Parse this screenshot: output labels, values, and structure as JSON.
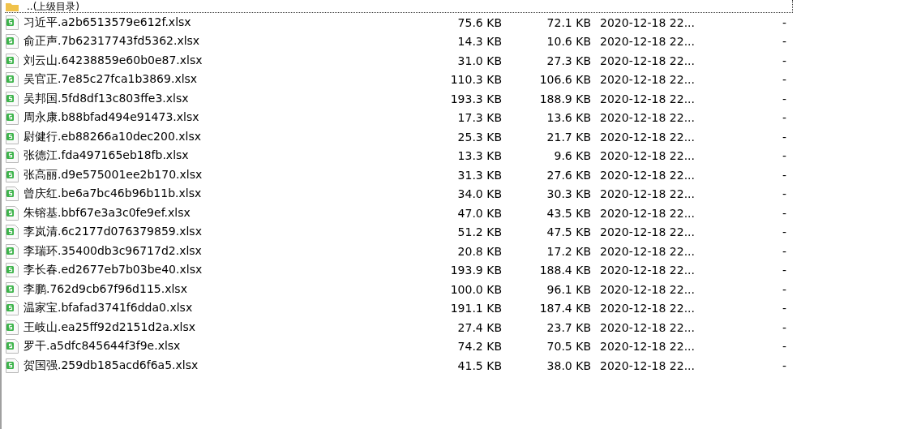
{
  "parent_row": {
    "name": "..(上级目录)",
    "focused": true
  },
  "files": [
    {
      "name": "习近平.a2b6513579e612f.xlsx",
      "size": "75.6 KB",
      "packed": "72.1 KB",
      "modified": "2020-12-18 22...",
      "column_5": "-"
    },
    {
      "name": "俞正声.7b62317743fd5362.xlsx",
      "size": "14.3 KB",
      "packed": "10.6 KB",
      "modified": "2020-12-18 22...",
      "column_5": "-"
    },
    {
      "name": "刘云山.64238859e60b0e87.xlsx",
      "size": "31.0 KB",
      "packed": "27.3 KB",
      "modified": "2020-12-18 22...",
      "column_5": "-"
    },
    {
      "name": "吴官正.7e85c27fca1b3869.xlsx",
      "size": "110.3 KB",
      "packed": "106.6 KB",
      "modified": "2020-12-18 22...",
      "column_5": "-"
    },
    {
      "name": "吴邦国.5fd8df13c803ffe3.xlsx",
      "size": "193.3 KB",
      "packed": "188.9 KB",
      "modified": "2020-12-18 22...",
      "column_5": "-"
    },
    {
      "name": "周永康.b88bfad494e91473.xlsx",
      "size": "17.3 KB",
      "packed": "13.6 KB",
      "modified": "2020-12-18 22...",
      "column_5": "-"
    },
    {
      "name": "尉健行.eb88266a10dec200.xlsx",
      "size": "25.3 KB",
      "packed": "21.7 KB",
      "modified": "2020-12-18 22...",
      "column_5": "-"
    },
    {
      "name": "张德江.fda497165eb18fb.xlsx",
      "size": "13.3 KB",
      "packed": "9.6 KB",
      "modified": "2020-12-18 22...",
      "column_5": "-"
    },
    {
      "name": "张高丽.d9e575001ee2b170.xlsx",
      "size": "31.3 KB",
      "packed": "27.6 KB",
      "modified": "2020-12-18 22...",
      "column_5": "-"
    },
    {
      "name": "曾庆红.be6a7bc46b96b11b.xlsx",
      "size": "34.0 KB",
      "packed": "30.3 KB",
      "modified": "2020-12-18 22...",
      "column_5": "-"
    },
    {
      "name": "朱镕基.bbf67e3a3c0fe9ef.xlsx",
      "size": "47.0 KB",
      "packed": "43.5 KB",
      "modified": "2020-12-18 22...",
      "column_5": "-"
    },
    {
      "name": "李岚清.6c2177d076379859.xlsx",
      "size": "51.2 KB",
      "packed": "47.5 KB",
      "modified": "2020-12-18 22...",
      "column_5": "-"
    },
    {
      "name": "李瑞环.35400db3c96717d2.xlsx",
      "size": "20.8 KB",
      "packed": "17.2 KB",
      "modified": "2020-12-18 22...",
      "column_5": "-"
    },
    {
      "name": "李长春.ed2677eb7b03be40.xlsx",
      "size": "193.9 KB",
      "packed": "188.4 KB",
      "modified": "2020-12-18 22...",
      "column_5": "-"
    },
    {
      "name": "李鹏.762d9cb67f96d115.xlsx",
      "size": "100.0 KB",
      "packed": "96.1 KB",
      "modified": "2020-12-18 22...",
      "column_5": "-"
    },
    {
      "name": "温家宝.bfafad3741f6dda0.xlsx",
      "size": "191.1 KB",
      "packed": "187.4 KB",
      "modified": "2020-12-18 22...",
      "column_5": "-"
    },
    {
      "name": "王岐山.ea25ff92d2151d2a.xlsx",
      "size": "27.4 KB",
      "packed": "23.7 KB",
      "modified": "2020-12-18 22...",
      "column_5": "-"
    },
    {
      "name": "罗干.a5dfc845644f3f9e.xlsx",
      "size": "74.2 KB",
      "packed": "70.5 KB",
      "modified": "2020-12-18 22...",
      "column_5": "-"
    },
    {
      "name": "贺国强.259db185acd6f6a5.xlsx",
      "size": "41.5 KB",
      "packed": "38.0 KB",
      "modified": "2020-12-18 22...",
      "column_5": "-"
    }
  ]
}
